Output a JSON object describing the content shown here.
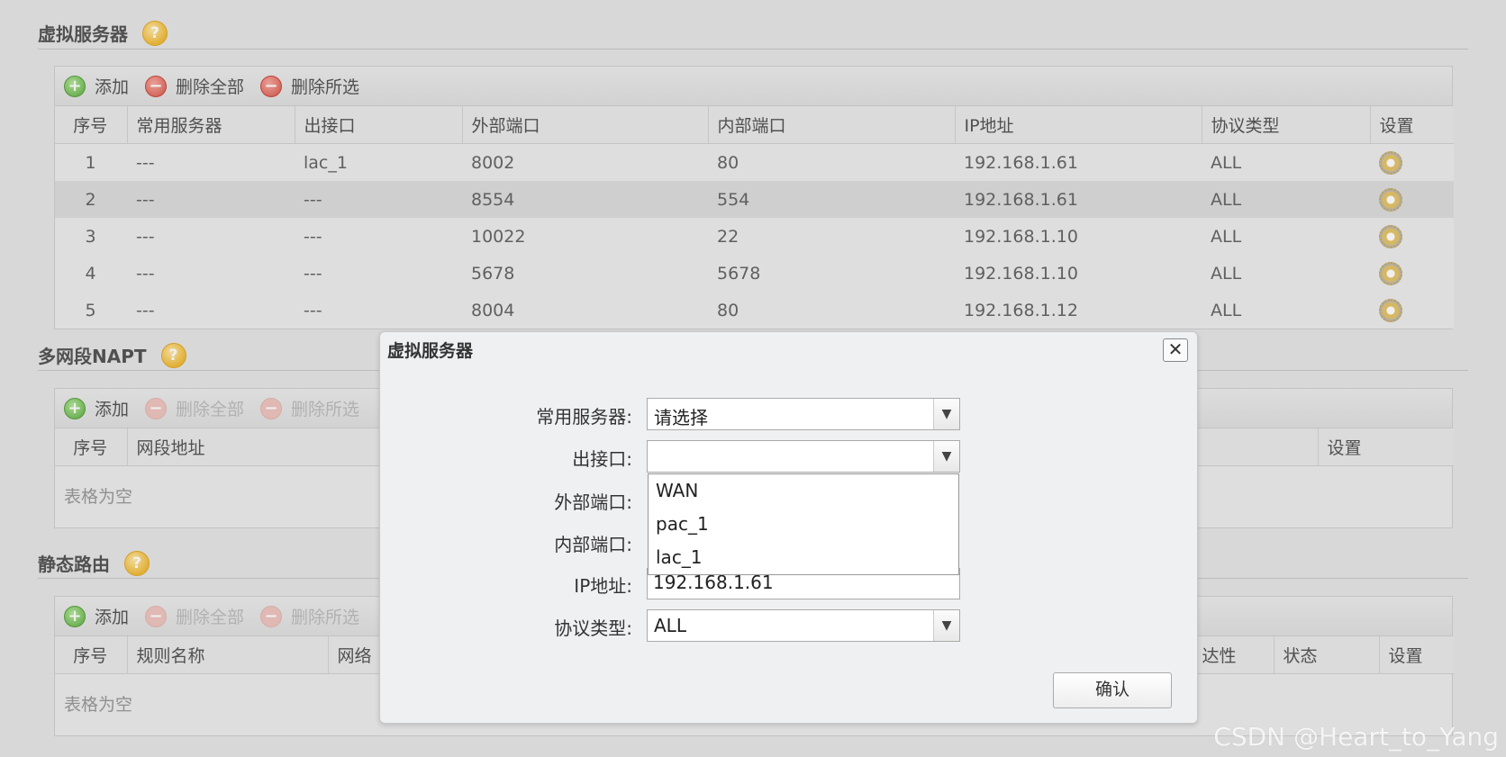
{
  "virtual_server": {
    "title": "虚拟服务器",
    "toolbar": {
      "add": "添加",
      "delete_all": "删除全部",
      "delete_selected": "删除所选"
    },
    "columns": [
      "序号",
      "常用服务器",
      "出接口",
      "外部端口",
      "内部端口",
      "IP地址",
      "协议类型",
      "设置"
    ],
    "rows": [
      [
        "1",
        "---",
        "lac_1",
        "8002",
        "80",
        "192.168.1.61",
        "ALL"
      ],
      [
        "2",
        "---",
        "---",
        "8554",
        "554",
        "192.168.1.61",
        "ALL"
      ],
      [
        "3",
        "---",
        "---",
        "10022",
        "22",
        "192.168.1.10",
        "ALL"
      ],
      [
        "4",
        "---",
        "---",
        "5678",
        "5678",
        "192.168.1.10",
        "ALL"
      ],
      [
        "5",
        "---",
        "---",
        "8004",
        "80",
        "192.168.1.12",
        "ALL"
      ]
    ]
  },
  "napt": {
    "title": "多网段NAPT",
    "toolbar": {
      "add": "添加",
      "delete_all": "删除全部",
      "delete_selected": "删除所选"
    },
    "columns": [
      "序号",
      "网段地址",
      "设置"
    ],
    "empty": "表格为空"
  },
  "static_route": {
    "title": "静态路由",
    "toolbar": {
      "add": "添加",
      "delete_all": "删除全部",
      "delete_selected": "删除所选"
    },
    "columns": [
      "序号",
      "规则名称",
      "网络",
      "达性",
      "状态",
      "设置"
    ],
    "empty": "表格为空"
  },
  "dialog": {
    "title": "虚拟服务器",
    "close": "✕",
    "fields": {
      "server_label": "常用服务器:",
      "server_value": "请选择",
      "iface_label": "出接口:",
      "iface_value": "",
      "ext_port_label": "外部端口:",
      "int_port_label": "内部端口:",
      "ip_label": "IP地址:",
      "ip_value": "192.168.1.61",
      "proto_label": "协议类型:",
      "proto_value": "ALL"
    },
    "dropdown_options": [
      "WAN",
      "pac_1",
      "lac_1"
    ],
    "confirm": "确认"
  },
  "icons": {
    "help": "?",
    "add": "+",
    "remove": "−",
    "dropdown": "▼"
  },
  "watermark": "CSDN @Heart_to_Yang"
}
